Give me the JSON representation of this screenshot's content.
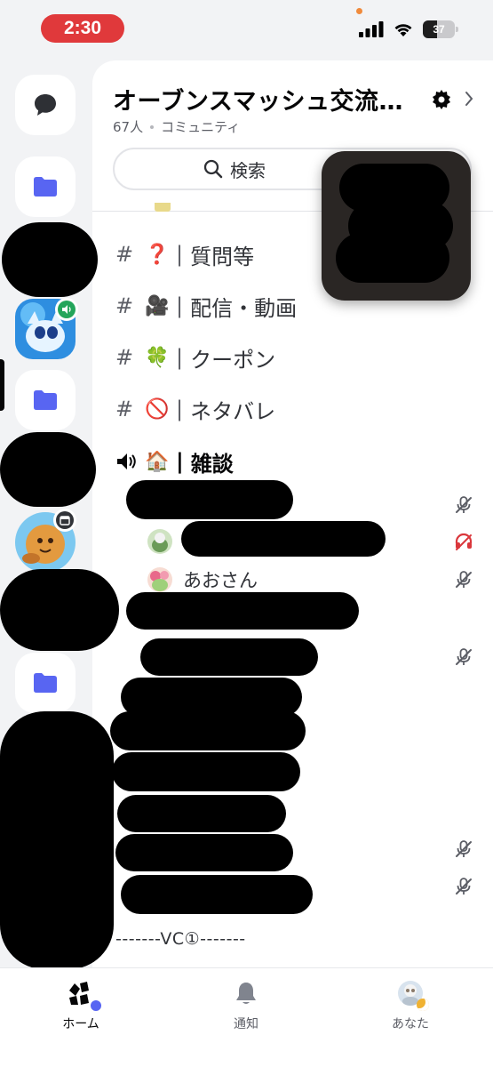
{
  "status_bar": {
    "time": "2:30",
    "battery": "37"
  },
  "server": {
    "name": "オーブンスマッシュ交流…",
    "member_count": "67人",
    "type": "コミュニティ"
  },
  "search": {
    "label": "検索"
  },
  "channels": [
    {
      "emoji": "❓",
      "name": "質問等"
    },
    {
      "emoji": "🎥",
      "name": "配信・動画"
    },
    {
      "emoji": "🍀",
      "name": "クーポン"
    },
    {
      "emoji": "🚫",
      "name": "ネタバレ"
    }
  ],
  "voice_channel": {
    "emoji": "🏠",
    "name": "雑談"
  },
  "members": [
    {
      "name": "あおさん"
    }
  ],
  "section_divider": "-------VC①-------",
  "nav": {
    "home": "ホーム",
    "notifications": "通知",
    "you": "あなた"
  },
  "colors": {
    "accent": "#5865f2",
    "time_pill": "#e0393b",
    "deafened": "#da373c"
  }
}
